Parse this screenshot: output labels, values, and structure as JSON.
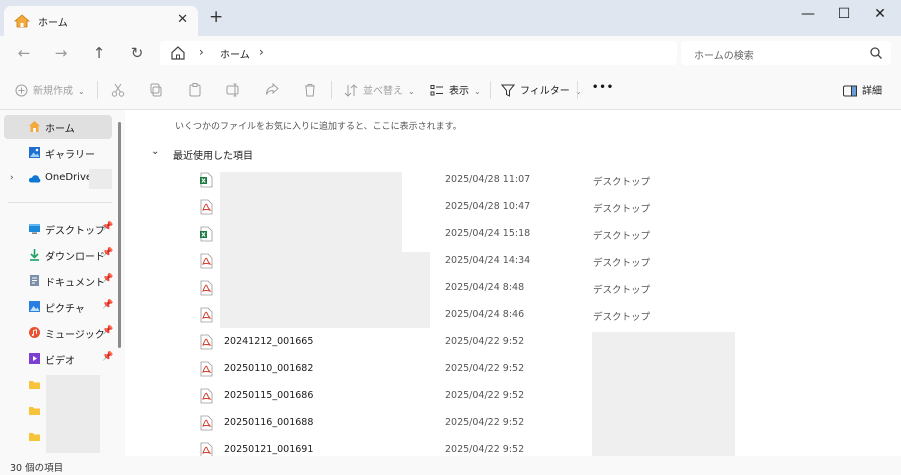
{
  "tab": {
    "title": "ホーム"
  },
  "window": {
    "minimize": "—",
    "maximize": "☐",
    "close": "✕"
  },
  "address": {
    "crumb": "ホーム",
    "search_placeholder": "ホームの検索"
  },
  "toolbar": {
    "new": "新規作成",
    "sort": "並べ替え",
    "view": "表示",
    "filter": "フィルター",
    "more": "•••",
    "details": "詳細"
  },
  "sidebar": {
    "items": [
      {
        "label": "ホーム",
        "icon": "home-icon"
      },
      {
        "label": "ギャラリー",
        "icon": "gallery-icon"
      },
      {
        "label": "OneDrive -",
        "icon": "cloud-icon"
      },
      {
        "label": "デスクトップ",
        "icon": "desktop-icon"
      },
      {
        "label": "ダウンロード",
        "icon": "download-icon"
      },
      {
        "label": "ドキュメント",
        "icon": "document-icon"
      },
      {
        "label": "ピクチャ",
        "icon": "picture-icon"
      },
      {
        "label": "ミュージック",
        "icon": "music-icon"
      },
      {
        "label": "ビデオ",
        "icon": "video-icon"
      }
    ]
  },
  "content": {
    "hint": "いくつかのファイルをお気に入りに追加すると、ここに表示されます。",
    "section_title": "最近使用した項目",
    "files": [
      {
        "name": "",
        "date": "2025/04/28 11:07",
        "location": "デスクトップ",
        "type": "excel"
      },
      {
        "name": "",
        "date": "2025/04/28 10:47",
        "location": "デスクトップ",
        "type": "pdf"
      },
      {
        "name": "",
        "date": "2025/04/24 15:18",
        "location": "デスクトップ",
        "type": "excel"
      },
      {
        "name": "",
        "date": "2025/04/24 14:34",
        "location": "デスクトップ",
        "type": "pdf"
      },
      {
        "name": "",
        "date": "2025/04/24 8:48",
        "location": "デスクトップ",
        "type": "pdf"
      },
      {
        "name": "",
        "date": "2025/04/24 8:46",
        "location": "デスクトップ",
        "type": "pdf"
      },
      {
        "name": "20241212_001665",
        "date": "2025/04/22 9:52",
        "location": "",
        "type": "pdf"
      },
      {
        "name": "20250110_001682",
        "date": "2025/04/22 9:52",
        "location": "",
        "type": "pdf"
      },
      {
        "name": "20250115_001686",
        "date": "2025/04/22 9:52",
        "location": "",
        "type": "pdf"
      },
      {
        "name": "20250116_001688",
        "date": "2025/04/22 9:52",
        "location": "",
        "type": "pdf"
      },
      {
        "name": "20250121_001691",
        "date": "2025/04/22 9:52",
        "location": "",
        "type": "pdf"
      }
    ]
  },
  "status": {
    "count": "30 個の項目"
  }
}
